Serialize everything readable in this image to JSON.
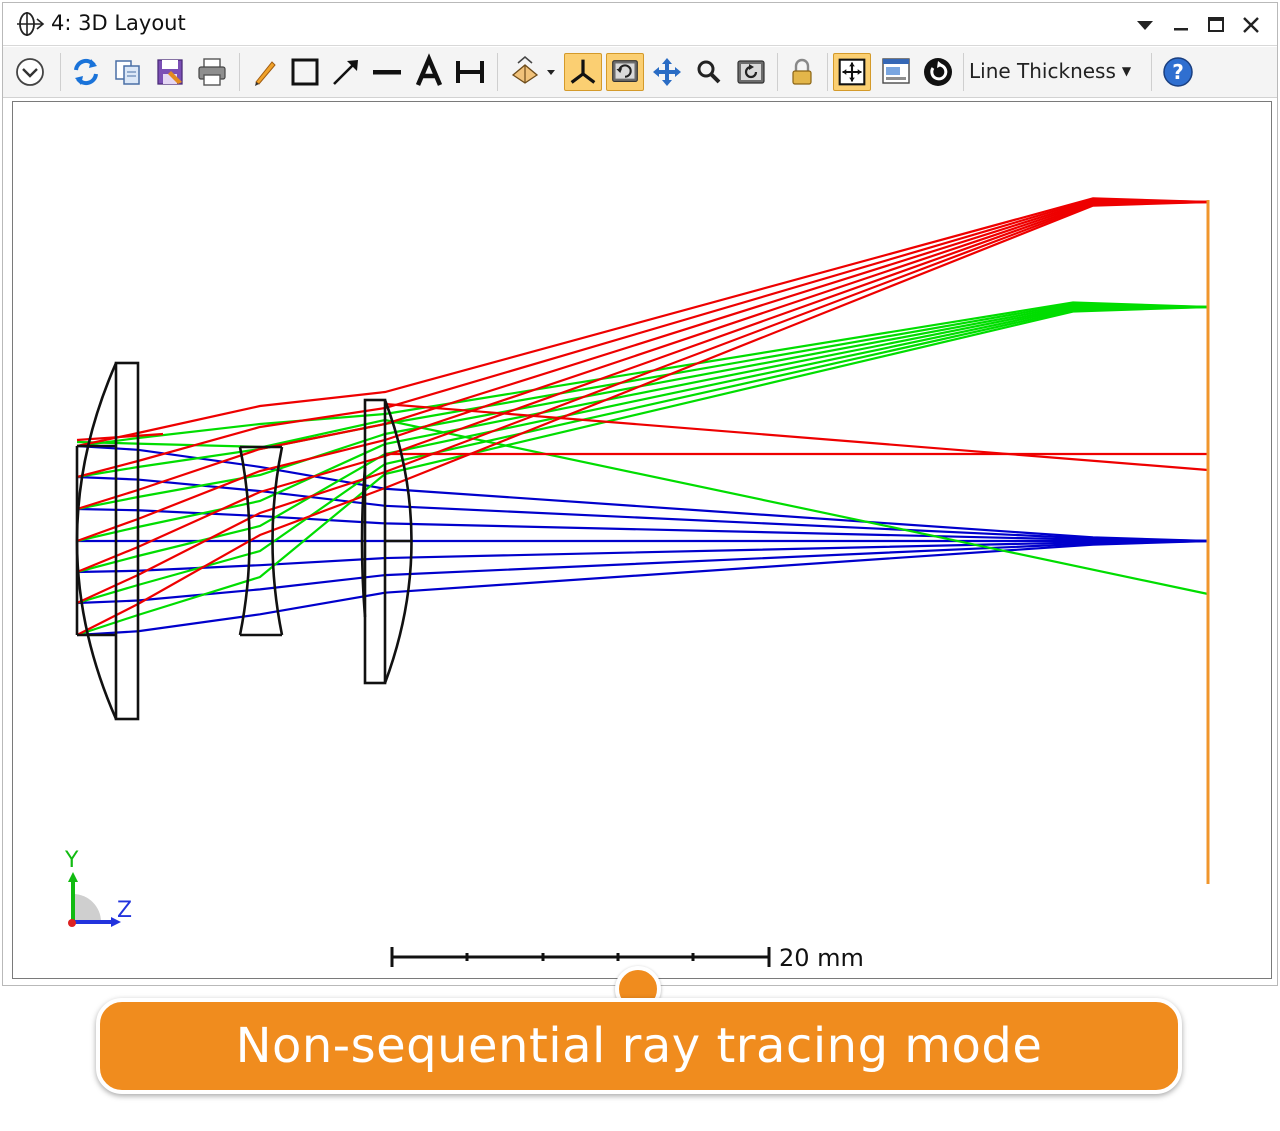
{
  "window": {
    "title": "4: 3D Layout"
  },
  "toolbar": {
    "line_thickness_label": "Line Thickness",
    "buttons": [
      "options-menu",
      "refresh",
      "copy",
      "save",
      "print",
      "pencil",
      "rectangle",
      "arrow",
      "line",
      "text",
      "dimension",
      "rotate-view",
      "axes-view",
      "redraw",
      "pan",
      "zoom",
      "reset-view",
      "lock",
      "fit",
      "window-setup",
      "reset"
    ]
  },
  "layout": {
    "scale_label": "20 mm",
    "axis_y_label": "Y",
    "axis_z_label": "Z",
    "ray_colors": {
      "field1": "#0000cc",
      "field2": "#00dd00",
      "field3": "#ee0000"
    },
    "image_plane_color": "#f0962c"
  },
  "banner": {
    "text": "Non-sequential ray tracing mode"
  }
}
